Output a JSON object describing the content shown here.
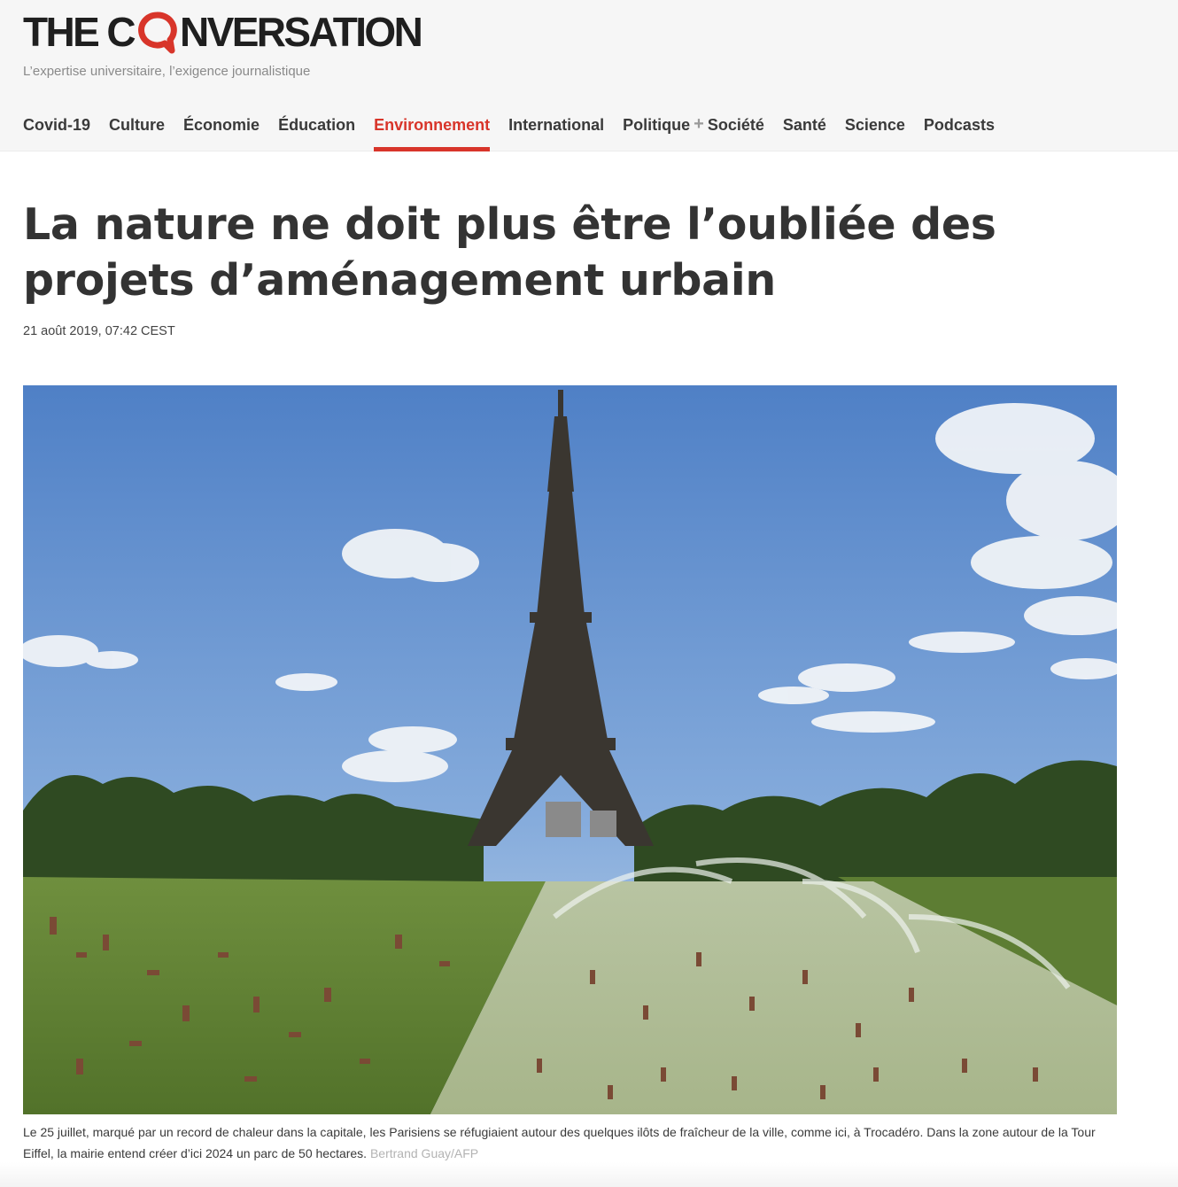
{
  "site": {
    "logo_left": "THE C",
    "logo_right": "NVERSATION",
    "tagline": "L’expertise universitaire, l’exigence journalistique",
    "brand_color": "#d8352a"
  },
  "nav": {
    "items": [
      "Covid-19",
      "Culture",
      "Économie",
      "Éducation",
      "Environnement",
      "International",
      "Politique",
      "Société",
      "Santé",
      "Science",
      "Podcasts"
    ],
    "plus_symbol": "+",
    "active": "Environnement"
  },
  "article": {
    "title": "La nature ne doit plus être l’oubliée des projets d’aménagement urbain",
    "date": "21 août 2019, 07:42 CEST",
    "image": {
      "subject": "Eiffel Tower seen from the Trocadéro fountains, crowds on the lawns and in the water on a hot day"
    },
    "caption": "Le 25 juillet, marqué par un record de chaleur dans la capitale, les Parisiens se réfugiaient autour des quelques ilôts de fraîcheur de la ville, comme ici, à Trocadéro. Dans la zone autour de la Tour Eiffel, la mairie entend créer d’ici 2024 un parc de 50 hectares.",
    "credit": "Bertrand Guay/AFP"
  }
}
